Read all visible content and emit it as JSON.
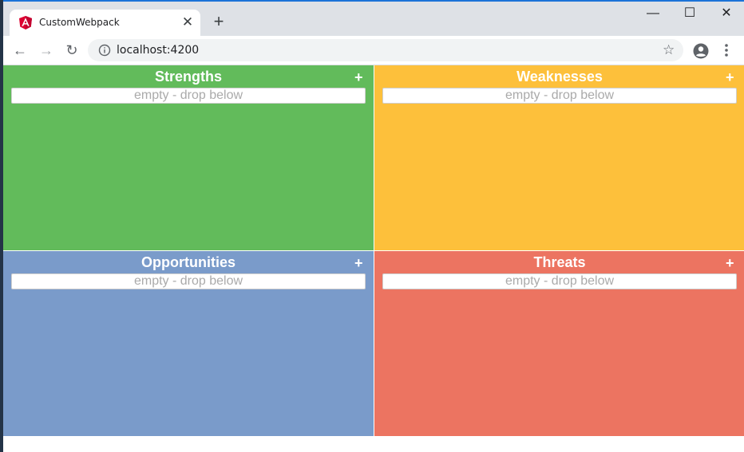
{
  "browser": {
    "tab_title": "CustomWebpack",
    "tab_close": "✕",
    "new_tab": "+",
    "window_controls": {
      "minimize": "—",
      "maximize": "☐",
      "close": "✕"
    },
    "url": "localhost:4200",
    "icons": [
      "angular-logo-icon",
      "back-icon",
      "forward-icon",
      "reload-icon",
      "info-icon",
      "star-icon",
      "profile-icon",
      "menu-icon"
    ],
    "nav": {
      "back": "←",
      "forward": "→",
      "reload": "↻",
      "star": "☆"
    }
  },
  "swot": {
    "quadrants": [
      {
        "title": "Strengths",
        "placeholder": "empty - drop below",
        "add": "+",
        "color": "#62bb5b"
      },
      {
        "title": "Weaknesses",
        "placeholder": "empty - drop below",
        "add": "+",
        "color": "#fdc03b"
      },
      {
        "title": "Opportunities",
        "placeholder": "empty - drop below",
        "add": "+",
        "color": "#7a9bca"
      },
      {
        "title": "Threats",
        "placeholder": "empty - drop below",
        "add": "+",
        "color": "#ec7461"
      }
    ]
  }
}
